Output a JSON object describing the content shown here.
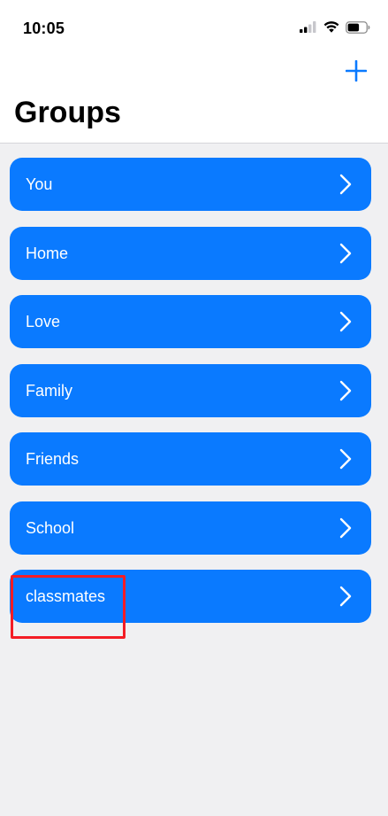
{
  "status_bar": {
    "time": "10:05",
    "icons": [
      "cellular-signal-icon",
      "wifi-icon",
      "battery-icon"
    ]
  },
  "nav": {
    "add_icon": "plus-icon",
    "title": "Groups"
  },
  "groups": [
    {
      "label": "You"
    },
    {
      "label": "Home"
    },
    {
      "label": "Love"
    },
    {
      "label": "Family"
    },
    {
      "label": "Friends"
    },
    {
      "label": "School"
    },
    {
      "label": "classmates"
    }
  ],
  "annotation": {
    "highlighted_item": "classmates"
  },
  "colors": {
    "accent": "#0a7aff",
    "row_background": "#0a7aff",
    "row_text": "#ffffff",
    "background": "#f0f0f2",
    "header_background": "#ffffff",
    "highlight_box": "#f41d25"
  }
}
